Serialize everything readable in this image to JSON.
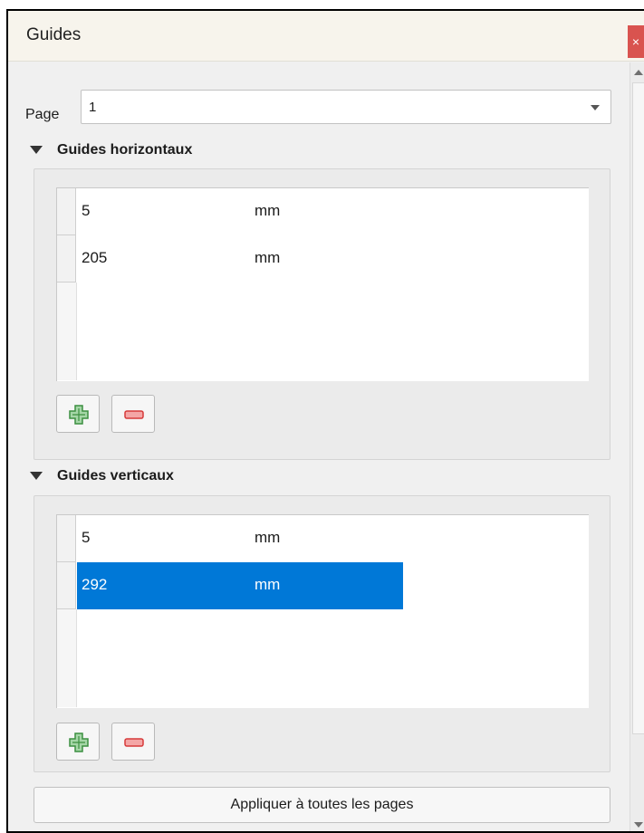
{
  "panel": {
    "title": "Guides",
    "close_label": "×"
  },
  "page_selector": {
    "label": "Page",
    "value": "1"
  },
  "horizontal": {
    "title": "Guides horizontaux",
    "rows": [
      {
        "value": "5",
        "unit": "mm",
        "selected": false
      },
      {
        "value": "205",
        "unit": "mm",
        "selected": false
      }
    ]
  },
  "vertical": {
    "title": "Guides verticaux",
    "rows": [
      {
        "value": "5",
        "unit": "mm",
        "selected": false
      },
      {
        "value": "292",
        "unit": "mm",
        "selected": true
      }
    ]
  },
  "buttons": {
    "add_icon": "plus-icon",
    "remove_icon": "minus-icon",
    "apply_label": "Appliquer à toutes les pages"
  },
  "colors": {
    "selection": "#0078d7",
    "add_green": "#4caf50",
    "remove_red": "#e04848",
    "close_red": "#d9534f"
  }
}
